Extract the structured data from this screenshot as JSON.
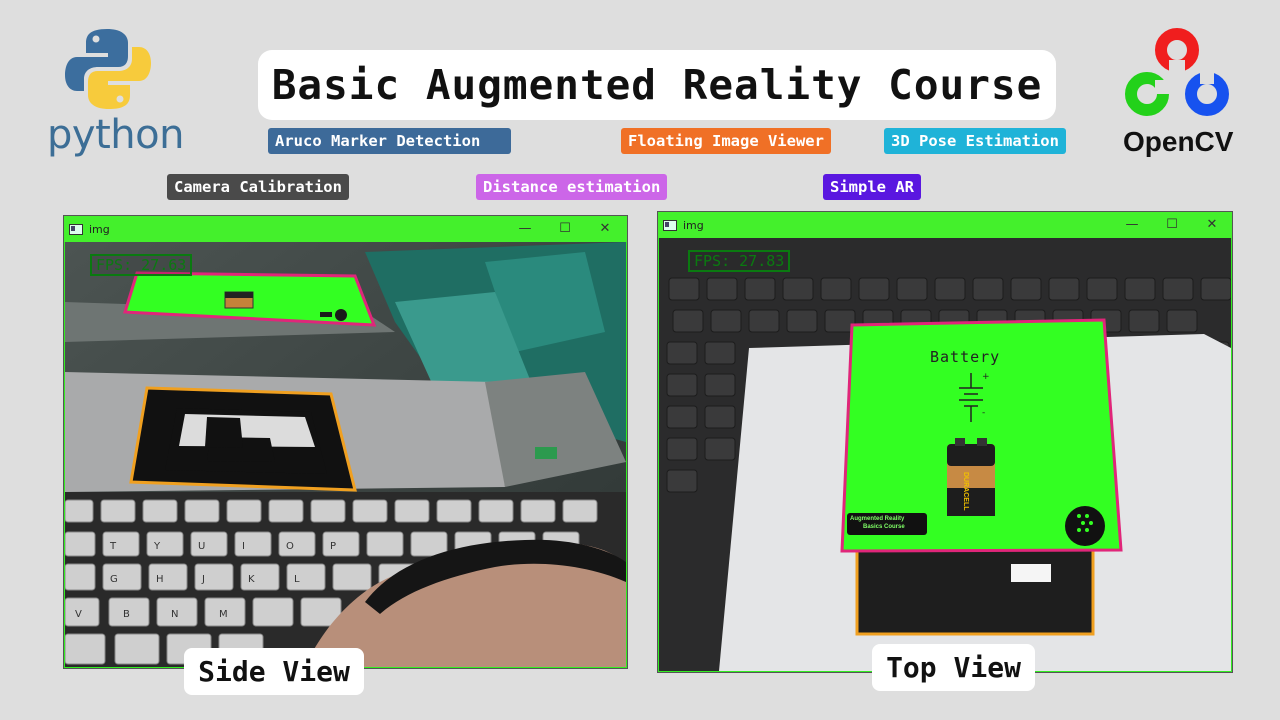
{
  "header": {
    "title": "Basic Augmented Reality Course",
    "python_logo_text": "python",
    "opencv_logo_text": "OpenCV"
  },
  "tags": [
    {
      "label": "Aruco Marker Detection",
      "color": "#3d6a99"
    },
    {
      "label": "Floating Image Viewer",
      "color": "#f07026"
    },
    {
      "label": "3D Pose Estimation",
      "color": "#1fb3d8"
    },
    {
      "label": "Camera Calibration",
      "color": "#4a4a4a"
    },
    {
      "label": "Distance estimation",
      "color": "#cc66e8"
    },
    {
      "label": "Simple AR",
      "color": "#5a17e0"
    }
  ],
  "windows": {
    "side": {
      "title": "img",
      "fps": "FPS: 27.63",
      "label": "Side View",
      "keys": [
        "T",
        "Y",
        "U",
        "I",
        "O",
        "P",
        "G",
        "H",
        "J",
        "K",
        "L",
        "V",
        "B",
        "N",
        "M"
      ]
    },
    "top": {
      "title": "img",
      "fps": "FPS: 27.83",
      "label": "Top View",
      "card_title": "Battery",
      "battery_brand": "DURACELL",
      "badge_line1": "Augmented Reality",
      "badge_line2": "Basics Course",
      "battery_plus": "+",
      "battery_minus": "-"
    }
  },
  "window_controls": {
    "minimize": "—",
    "maximize": "☐",
    "close": "✕"
  },
  "colors": {
    "overlay_green": "#33ff22",
    "overlay_border": "#e0267a",
    "marker_outline": "#f0a020",
    "background": "#dedede"
  }
}
